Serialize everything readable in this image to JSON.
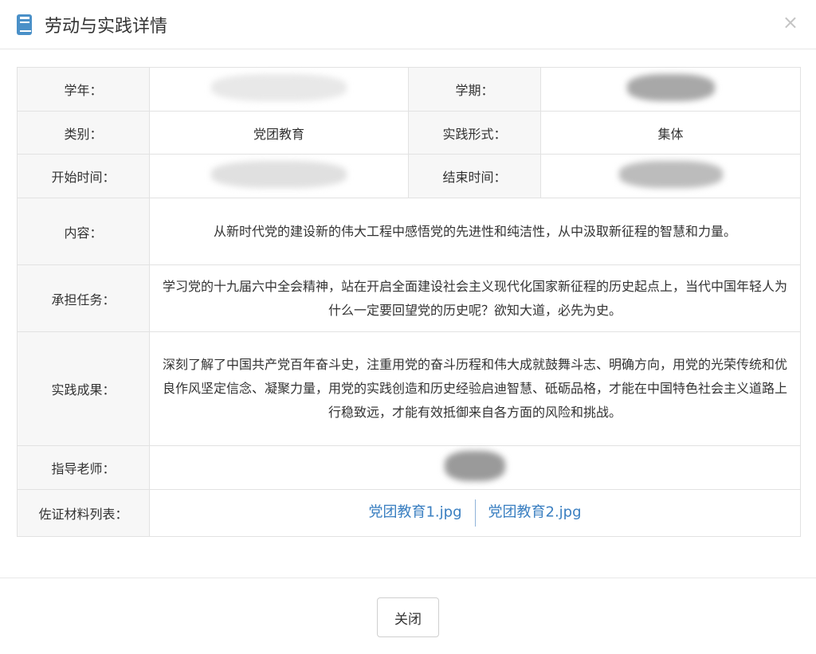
{
  "dialog": {
    "title": "劳动与实践详情",
    "close_symbol": "×"
  },
  "labels": {
    "year": "学年：",
    "term": "学期：",
    "category": "类别：",
    "form": "实践形式：",
    "start": "开始时间：",
    "end": "结束时间：",
    "content": "内容：",
    "task": "承担任务：",
    "result": "实践成果：",
    "teacher": "指导老师：",
    "evidence": "佐证材料列表："
  },
  "values": {
    "category": "党团教育",
    "form": "集体",
    "content": "从新时代党的建设新的伟大工程中感悟党的先进性和纯洁性，从中汲取新征程的智慧和力量。",
    "task": "学习党的十九届六中全会精神，站在开启全面建设社会主义现代化国家新征程的历史起点上，当代中国年轻人为什么一定要回望党的历史呢？欲知大道，必先为史。",
    "result": "深刻了解了中国共产党百年奋斗史，注重用党的奋斗历程和伟大成就鼓舞斗志、明确方向，用党的光荣传统和优良作风坚定信念、凝聚力量，用党的实践创造和历史经验启迪智慧、砥砺品格，才能在中国特色社会主义道路上行稳致远，才能有效抵御来自各方面的风险和挑战。"
  },
  "files": [
    "党团教育1.jpg",
    "党团教育2.jpg"
  ],
  "footer": {
    "close_label": "关闭"
  },
  "icons": {
    "title_icon": "book-icon",
    "close_icon": "close-icon"
  },
  "colors": {
    "link": "#3a7fc1",
    "icon": "#4a90c8",
    "label_bg": "#f7f7f7",
    "border": "#e2e2e2"
  }
}
